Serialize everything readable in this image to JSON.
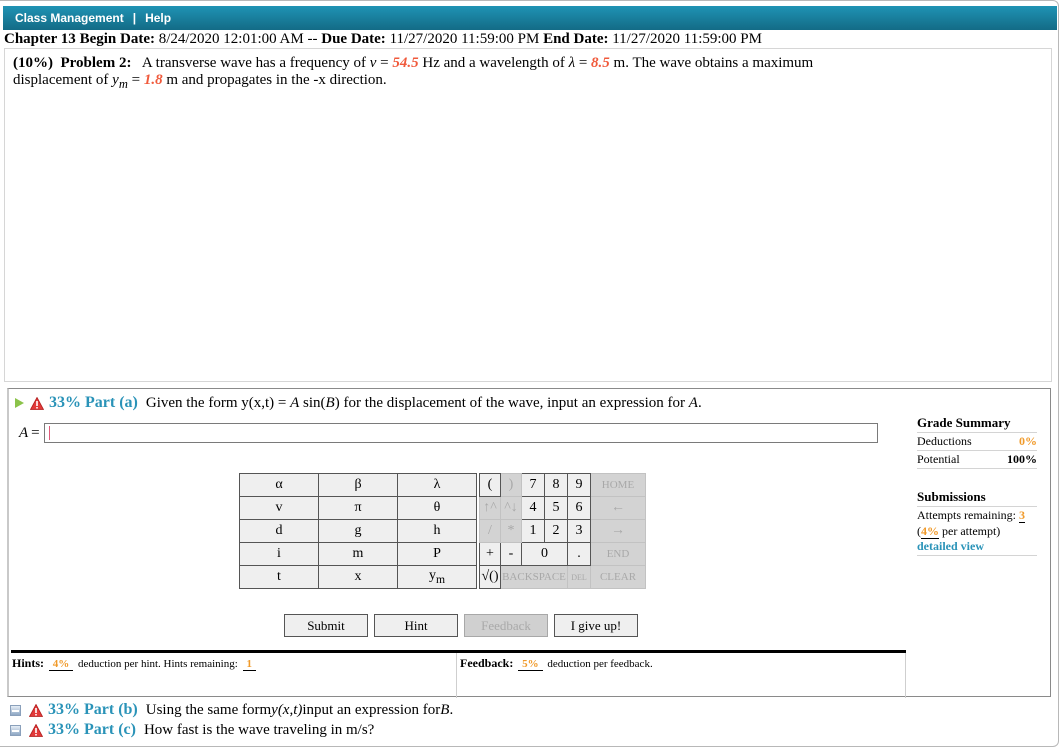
{
  "nav": {
    "items": [
      "Class Management",
      "Help"
    ],
    "separator": "|"
  },
  "dates": {
    "chapter_label": "Chapter 13",
    "begin_label": "Begin Date:",
    "begin_value": "8/24/2020 12:01:00 AM",
    "sep": "--",
    "due_label": "Due Date:",
    "due_value": "11/27/2020 11:59:00 PM",
    "end_label": "End Date:",
    "end_value": "11/27/2020 11:59:00 PM"
  },
  "problem": {
    "weight": "(10%)",
    "title": "Problem 2:",
    "text_1": "A transverse wave has a frequency of",
    "nu_symbol": "v",
    "eq": " = ",
    "frequency": "54.5",
    "text_2": " Hz and a wavelength of ",
    "lambda_symbol": "λ",
    "wavelength": "8.5",
    "text_3": " m. The wave obtains a maximum displacement of ",
    "ym_symbol": "y",
    "ym_sub": "m",
    "displacement": "1.8",
    "text_4": " m and propagates in the -x direction."
  },
  "part_a": {
    "percent_label": "33% Part (a)",
    "question_1": "Given the form y(x,t) = ",
    "A": "A",
    "question_2": " sin(",
    "B": "B",
    "question_3": ") for the displacement of the wave, input an expression for ",
    "question_4": ".",
    "answer_label": "A",
    "answer_eq": "=",
    "answer_value": ""
  },
  "keypad": {
    "vars": [
      [
        "α",
        "β",
        "λ"
      ],
      [
        "v",
        "π",
        "θ"
      ],
      [
        "d",
        "g",
        "h"
      ],
      [
        "i",
        "m",
        "P"
      ],
      [
        "t",
        "x",
        "ym"
      ]
    ],
    "row1": [
      "(",
      ")",
      "7",
      "8",
      "9",
      "HOME"
    ],
    "row2": [
      "↑^",
      "^↓",
      "4",
      "5",
      "6",
      "←"
    ],
    "row3": [
      "/",
      "*",
      "1",
      "2",
      "3",
      "→"
    ],
    "row4": [
      "+",
      "-",
      "0",
      ".",
      "END"
    ],
    "row5": [
      "√()",
      "BACKSPACE",
      "DEL",
      "CLEAR"
    ]
  },
  "buttons": {
    "submit": "Submit",
    "hint": "Hint",
    "feedback": "Feedback",
    "give_up": "I give up!"
  },
  "grade_summary": {
    "title": "Grade Summary",
    "deductions_label": "Deductions",
    "deductions_value": "0%",
    "potential_label": "Potential",
    "potential_value": "100%",
    "submissions_title": "Submissions",
    "attempts_label": "Attempts remaining:",
    "attempts_value": "3",
    "per_attempt_open": "(",
    "per_attempt_value": "4%",
    "per_attempt_text": " per attempt)",
    "detailed_view": "detailed view"
  },
  "hints": {
    "label": "Hints:",
    "deduction": "4%",
    "text": "deduction per hint. Hints remaining:",
    "remaining": "1"
  },
  "feedback": {
    "label": "Feedback:",
    "deduction": "5%",
    "text": "deduction per feedback."
  },
  "other_parts": [
    {
      "label": "33% Part (b)",
      "q1": "Using the same form ",
      "q_it": "y(x,t)",
      "q2": " input an expression for ",
      "q_it2": "B",
      "q3": "."
    },
    {
      "label": "33% Part (c)",
      "q1": "How fast is the wave traveling in m/s?"
    }
  ],
  "colors": {
    "accent_blue": "#2a93b8",
    "highlight_red": "#f05a3c",
    "orange": "#f09a2a",
    "header_gradient_top": "#1f93b4",
    "header_gradient_bottom": "#136b86"
  }
}
